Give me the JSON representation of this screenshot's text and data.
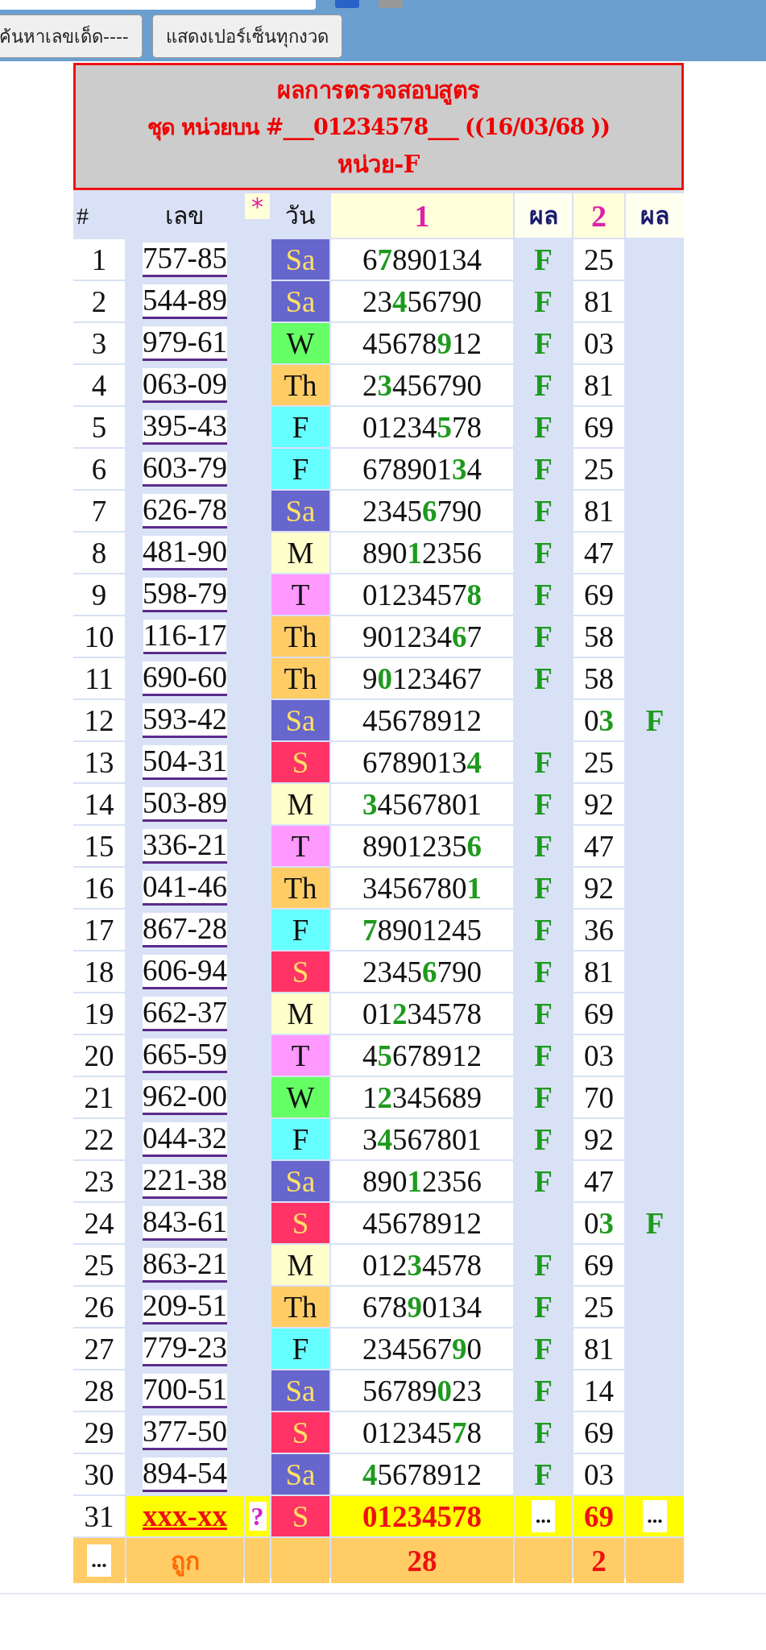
{
  "toolbar": {
    "filters": [
      {
        "checked": true
      },
      {
        "checked": false
      }
    ],
    "buttons": [
      "ค้นหาเลขเด็ด----",
      "แสดงเปอร์เซ็นทุกงวด"
    ]
  },
  "report": {
    "title_lines": [
      "ผลการตรวจสอบสูตร",
      "ชุด หน่วยบน #___01234578___ ((16/03/68 ))",
      "หน่วย-F"
    ]
  },
  "table": {
    "columns": [
      "#",
      "เลข",
      "*",
      "วัน",
      "1",
      "ผล",
      "2",
      "ผล"
    ],
    "rows": [
      {
        "kind": "checked",
        "no": "1",
        "number": "757-85",
        "day": "Sa",
        "color": "#6666cc",
        "formula": "6**7**890134",
        "result_1": "F",
        "pair": "25"
      },
      {
        "kind": "checked",
        "no": "2",
        "number": "544-89",
        "day": "Sa",
        "color": "#6666cc",
        "formula": "23**4**56790",
        "result_1": "F",
        "pair": "81"
      },
      {
        "kind": "checked",
        "no": "3",
        "number": "979-61",
        "day": "W",
        "color": "#66ff66",
        "formula": "45678**9**12",
        "result_1": "F",
        "pair": "03"
      },
      {
        "kind": "checked",
        "no": "4",
        "number": "063-09",
        "day": "Th",
        "color": "#ffcc66",
        "formula": "2**3**456790",
        "result_1": "F",
        "pair": "81"
      },
      {
        "kind": "checked",
        "no": "5",
        "number": "395-43",
        "day": "F",
        "color": "#66ffff",
        "formula": "01234**5**78",
        "result_1": "F",
        "pair": "69"
      },
      {
        "kind": "checked",
        "no": "6",
        "number": "603-79",
        "day": "F",
        "color": "#66ffff",
        "formula": "678901**3**4",
        "result_1": "F",
        "pair": "25"
      },
      {
        "kind": "checked",
        "no": "7",
        "number": "626-78",
        "day": "Sa",
        "color": "#6666cc",
        "formula": "2345**6**790",
        "result_1": "F",
        "pair": "81"
      },
      {
        "kind": "checked",
        "no": "8",
        "number": "481-90",
        "day": "M",
        "color": "#ffffcc",
        "formula": "890**1**2356",
        "result_1": "F",
        "pair": "47"
      },
      {
        "kind": "checked",
        "no": "9",
        "number": "598-79",
        "day": "T",
        "color": "#ff99ff",
        "formula": "0123457**8**",
        "result_1": "F",
        "pair": "69"
      },
      {
        "kind": "checked",
        "no": "10",
        "number": "116-17",
        "day": "Th",
        "color": "#ffcc66",
        "formula": "901234**6**7",
        "result_1": "F",
        "pair": "58"
      },
      {
        "kind": "checked",
        "no": "11",
        "number": "690-60",
        "day": "Th",
        "color": "#ffcc66",
        "formula": "9**0**123467",
        "result_1": "F",
        "pair": "58"
      },
      {
        "kind": "checked",
        "no": "12",
        "number": "593-42",
        "day": "Sa",
        "color": "#6666cc",
        "formula": "45678912",
        "pair": "0**3**",
        "result_2": "F"
      },
      {
        "kind": "checked",
        "no": "13",
        "number": "504-31",
        "day": "S",
        "color": "#ff3366",
        "formula": "6789013**4**",
        "result_1": "F",
        "pair": "25"
      },
      {
        "kind": "checked",
        "no": "14",
        "number": "503-89",
        "day": "M",
        "color": "#ffffcc",
        "formula": "**3**4567801",
        "result_1": "F",
        "pair": "92"
      },
      {
        "kind": "checked",
        "no": "15",
        "number": "336-21",
        "day": "T",
        "color": "#ff99ff",
        "formula": "8901235**6**",
        "result_1": "F",
        "pair": "47"
      },
      {
        "kind": "checked",
        "no": "16",
        "number": "041-46",
        "day": "Th",
        "color": "#ffcc66",
        "formula": "3456780**1**",
        "result_1": "F",
        "pair": "92"
      },
      {
        "kind": "checked",
        "no": "17",
        "number": "867-28",
        "day": "F",
        "color": "#66ffff",
        "formula": "**7**8901245",
        "result_1": "F",
        "pair": "36"
      },
      {
        "kind": "checked",
        "no": "18",
        "number": "606-94",
        "day": "S",
        "color": "#ff3366",
        "formula": "2345**6**790",
        "result_1": "F",
        "pair": "81"
      },
      {
        "kind": "checked",
        "no": "19",
        "number": "662-37",
        "day": "M",
        "color": "#ffffcc",
        "formula": "01**2**34578",
        "result_1": "F",
        "pair": "69"
      },
      {
        "kind": "checked",
        "no": "20",
        "number": "665-59",
        "day": "T",
        "color": "#ff99ff",
        "formula": "4**5**678912",
        "result_1": "F",
        "pair": "03"
      },
      {
        "kind": "checked",
        "no": "21",
        "number": "962-00",
        "day": "W",
        "color": "#66ff66",
        "formula": "1**2**345689",
        "result_1": "F",
        "pair": "70"
      },
      {
        "kind": "checked",
        "no": "22",
        "number": "044-32",
        "day": "F",
        "color": "#66ffff",
        "formula": "3**4**567801",
        "result_1": "F",
        "pair": "92"
      },
      {
        "kind": "checked",
        "no": "23",
        "number": "221-38",
        "day": "Sa",
        "color": "#6666cc",
        "formula": "890**1**2356",
        "result_1": "F",
        "pair": "47"
      },
      {
        "kind": "checked",
        "no": "24",
        "number": "843-61",
        "day": "S",
        "color": "#ff3366",
        "formula": "45678912",
        "pair": "0**3**",
        "result_2": "F"
      },
      {
        "kind": "checked",
        "no": "25",
        "number": "863-21",
        "day": "M",
        "color": "#ffffcc",
        "formula": "012**3**4578",
        "result_1": "F",
        "pair": "69"
      },
      {
        "kind": "checked",
        "no": "26",
        "number": "209-51",
        "day": "Th",
        "color": "#ffcc66",
        "formula": "678**9**0134",
        "result_1": "F",
        "pair": "25"
      },
      {
        "kind": "checked",
        "no": "27",
        "number": "779-23",
        "day": "F",
        "color": "#66ffff",
        "formula": "234567**9**0",
        "result_1": "F",
        "pair": "81"
      },
      {
        "kind": "checked",
        "no": "28",
        "number": "700-51",
        "day": "Sa",
        "color": "#6666cc",
        "formula": "56789**0**23",
        "result_1": "F",
        "pair": "14"
      },
      {
        "kind": "checked",
        "no": "29",
        "number": "377-50",
        "day": "S",
        "color": "#ff3366",
        "formula": "012345**7**8",
        "result_1": "F",
        "pair": "69"
      },
      {
        "kind": "checked",
        "no": "30",
        "number": "894-54",
        "day": "Sa",
        "color": "#6666cc",
        "formula": "**4**5678912",
        "result_1": "F",
        "pair": "03"
      },
      {
        "kind": "pending",
        "no": "31",
        "number": "xxx-xx",
        "mark": "?",
        "day": "S",
        "color": "#ff3366",
        "formula": "01234578",
        "result_1": "...",
        "pair": "69",
        "result_2": "..."
      }
    ],
    "totals": {
      "no": "...",
      "label": "ถูก",
      "count_1": "28",
      "count_2": "2"
    }
  }
}
